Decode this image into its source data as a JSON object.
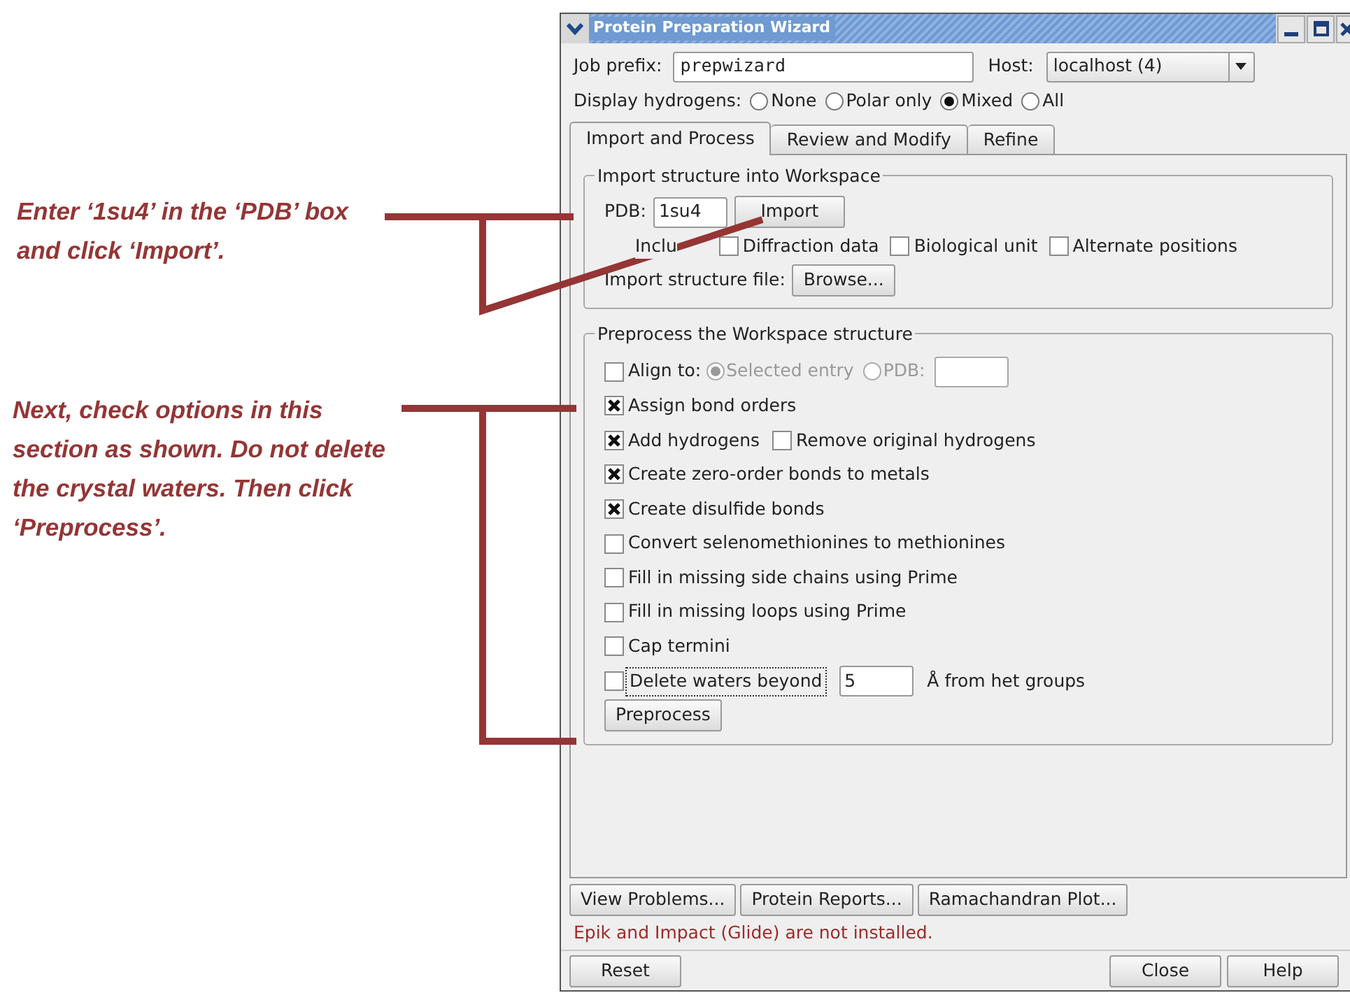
{
  "callouts": [
    {
      "text": "Enter ‘1su4’ in the ‘PDB’ box and click ‘Import’."
    },
    {
      "text": "Next, check options in this section as shown. Do not delete the crystal waters. Then click ‘Preprocess’."
    }
  ],
  "window": {
    "title": "Protein Preparation Wizard"
  },
  "job_prefix": {
    "label": "Job prefix:",
    "value": "prepwizard"
  },
  "host": {
    "label": "Host:",
    "value": "localhost (4)"
  },
  "display_hydrogens": {
    "label": "Display hydrogens:",
    "options": [
      {
        "label": "None",
        "selected": false
      },
      {
        "label": "Polar only",
        "selected": false
      },
      {
        "label": "Mixed",
        "selected": true
      },
      {
        "label": "All",
        "selected": false
      }
    ]
  },
  "tabs": [
    {
      "label": "Import and Process",
      "selected": true
    },
    {
      "label": "Review and Modify",
      "selected": false
    },
    {
      "label": "Refine",
      "selected": false
    }
  ],
  "import_group": {
    "title": "Import structure into Workspace",
    "pdb_label": "PDB:",
    "pdb_value": "1su4",
    "import_button": "Import",
    "include_label": "Inclu",
    "options": [
      {
        "label": "Diffraction data",
        "checked": false
      },
      {
        "label": "Biological unit",
        "checked": false
      },
      {
        "label": "Alternate positions",
        "checked": false
      }
    ],
    "file_label": "Import structure file:",
    "browse_button": "Browse..."
  },
  "preprocess_group": {
    "title": "Preprocess the Workspace structure",
    "align": {
      "label": "Align to:",
      "checked": false,
      "choices": [
        {
          "label": "Selected entry",
          "selected": true,
          "disabled": true
        },
        {
          "label": "PDB:",
          "selected": false,
          "disabled": true
        }
      ]
    },
    "rows": [
      [
        {
          "label": "Assign bond orders",
          "checked": true
        }
      ],
      [
        {
          "label": "Add hydrogens",
          "checked": true
        },
        {
          "label": "Remove original hydrogens",
          "checked": false
        }
      ],
      [
        {
          "label": "Create zero-order bonds to metals",
          "checked": true
        }
      ],
      [
        {
          "label": "Create disulfide bonds",
          "checked": true
        }
      ],
      [
        {
          "label": "Convert selenomethionines to methionines",
          "checked": false
        }
      ],
      [
        {
          "label": "Fill in missing side chains using Prime",
          "checked": false
        }
      ],
      [
        {
          "label": "Fill in missing loops using Prime",
          "checked": false
        }
      ],
      [
        {
          "label": "Cap termini",
          "checked": false
        }
      ]
    ],
    "waters": {
      "label": "Delete waters beyond",
      "checked": false,
      "value": "5",
      "suffix": "Å from het groups"
    },
    "preprocess_button": "Preprocess"
  },
  "actions": [
    "View Problems...",
    "Protein Reports...",
    "Ramachandran Plot..."
  ],
  "message": "Epik and Impact (Glide) are not installed.",
  "footer": {
    "left": [
      "Reset"
    ],
    "right": [
      "Close",
      "Help"
    ]
  }
}
